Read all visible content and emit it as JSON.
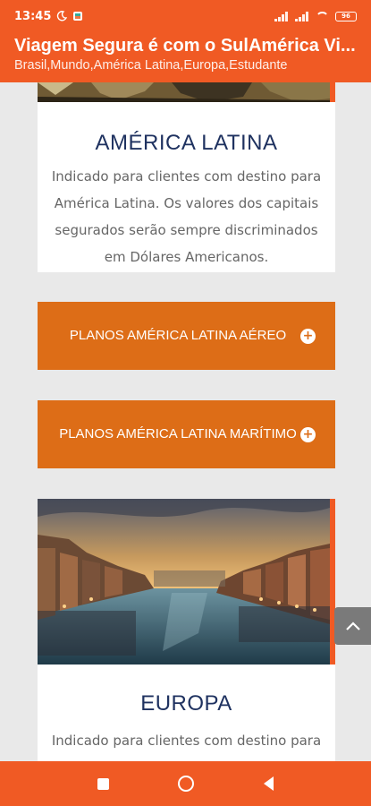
{
  "status": {
    "time": "13:45",
    "battery": "96"
  },
  "appbar": {
    "title": "Viagem Segura é com o SulAmérica Vi...",
    "subtitle": "Brasil,Mundo,América Latina,Europa,Estudante"
  },
  "cards": [
    {
      "title": "AMÉRICA LATINA",
      "text": "Indicado para clientes com destino para América Latina. Os valores dos capitais segurados serão sempre discriminados em Dólares Americanos."
    },
    {
      "title": "EUROPA",
      "text": "Indicado para clientes com destino para"
    }
  ],
  "buttons": [
    {
      "label": "PLANOS AMÉRICA LATINA AÉREO"
    },
    {
      "label": "PLANOS AMÉRICA LATINA MARÍTIMO"
    }
  ],
  "colors": {
    "brand": "#f05a24",
    "button": "#dd6d17",
    "title": "#1f3260"
  }
}
